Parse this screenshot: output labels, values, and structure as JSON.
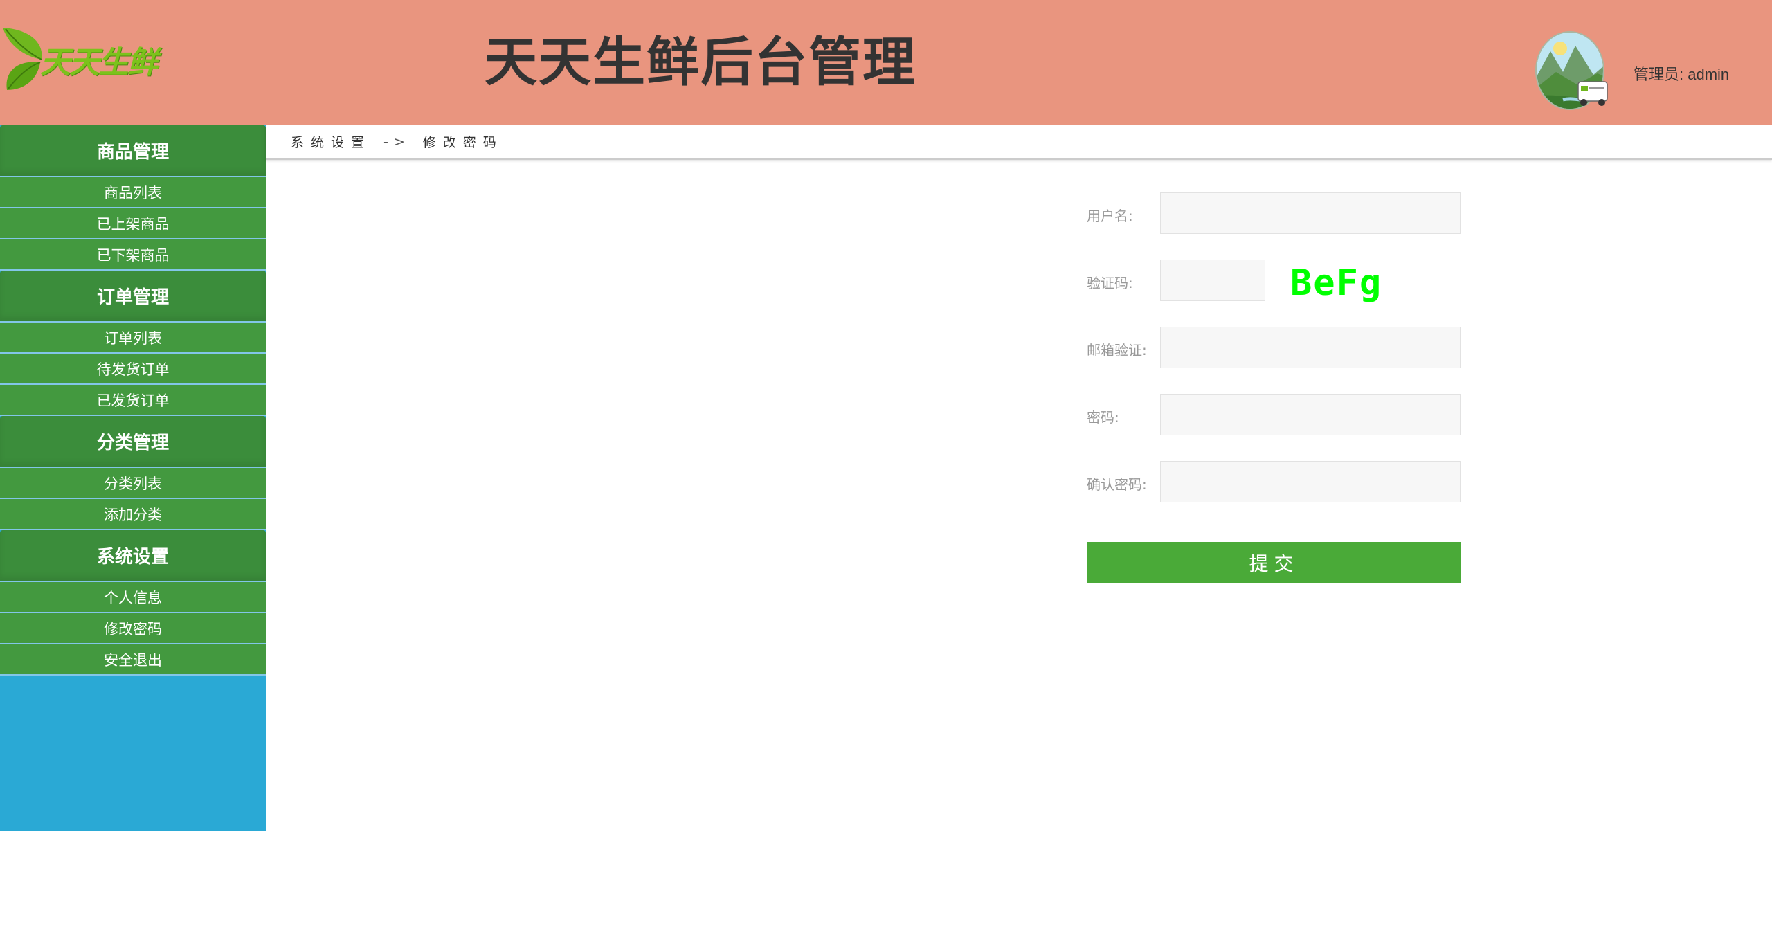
{
  "header": {
    "logo_text": "天天生鲜",
    "title": "天天生鲜后台管理",
    "admin_label": "管理员: admin",
    "background_color": "#e9957f"
  },
  "sidebar": {
    "groups": [
      {
        "title": "商品管理",
        "items": [
          {
            "label": "商品列表"
          },
          {
            "label": "已上架商品"
          },
          {
            "label": "已下架商品"
          }
        ]
      },
      {
        "title": "订单管理",
        "items": [
          {
            "label": "订单列表"
          },
          {
            "label": "待发货订单"
          },
          {
            "label": "已发货订单"
          }
        ]
      },
      {
        "title": "分类管理",
        "items": [
          {
            "label": "分类列表"
          },
          {
            "label": "添加分类"
          }
        ]
      },
      {
        "title": "系统设置",
        "items": [
          {
            "label": "个人信息"
          },
          {
            "label": "修改密码"
          },
          {
            "label": "安全退出"
          }
        ]
      }
    ],
    "group_color": "#3b8d3b",
    "item_color": "#43993f",
    "background_color": "#2aa9d5"
  },
  "breadcrumb": {
    "section": "系统设置",
    "separator": "->",
    "current": "修改密码"
  },
  "form": {
    "username_label": "用户名:",
    "username_value": "",
    "captcha_label": "验证码:",
    "captcha_value": "",
    "captcha_text": "BeFg",
    "email_label": "邮箱验证:",
    "email_value": "",
    "password_label": "密码:",
    "password_value": "",
    "confirm_label": "确认密码:",
    "confirm_value": "",
    "submit_label": "提交",
    "submit_color": "#4aaa38"
  },
  "icons": {
    "logo": "leaf-logo-icon",
    "avatar": "landscape-avatar-icon"
  }
}
